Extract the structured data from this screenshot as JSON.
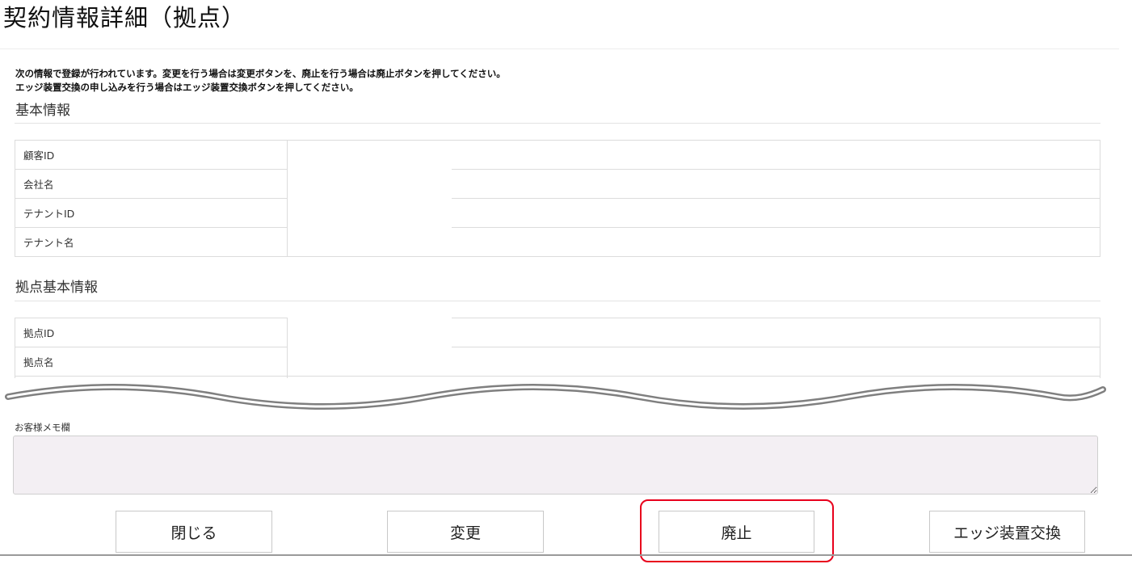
{
  "page": {
    "title": "契約情報詳細（拠点）"
  },
  "instructions": {
    "line1": "次の情報で登録が行われています。変更を行う場合は変更ボタンを、廃止を行う場合は廃止ボタンを押してください。",
    "line2": "エッジ装置交換の申し込みを行う場合はエッジ装置交換ボタンを押してください。"
  },
  "basic_info": {
    "heading": "基本情報",
    "rows": [
      {
        "label": "顧客ID",
        "value": ""
      },
      {
        "label": "会社名",
        "value": ""
      },
      {
        "label": "テナントID",
        "value": ""
      },
      {
        "label": "テナント名",
        "value": ""
      }
    ]
  },
  "site_info": {
    "heading": "拠点基本情報",
    "rows": [
      {
        "label": "拠点ID",
        "value": ""
      },
      {
        "label": "拠点名",
        "value": ""
      }
    ]
  },
  "memo": {
    "label": "お客様メモ欄",
    "value": ""
  },
  "buttons": {
    "close": "閉じる",
    "change": "変更",
    "cancel": "廃止",
    "edge_replace": "エッジ装置交換"
  },
  "colors": {
    "highlight": "#e8001c",
    "memo_background": "#f3eff3",
    "border": "#dcdcdc"
  }
}
